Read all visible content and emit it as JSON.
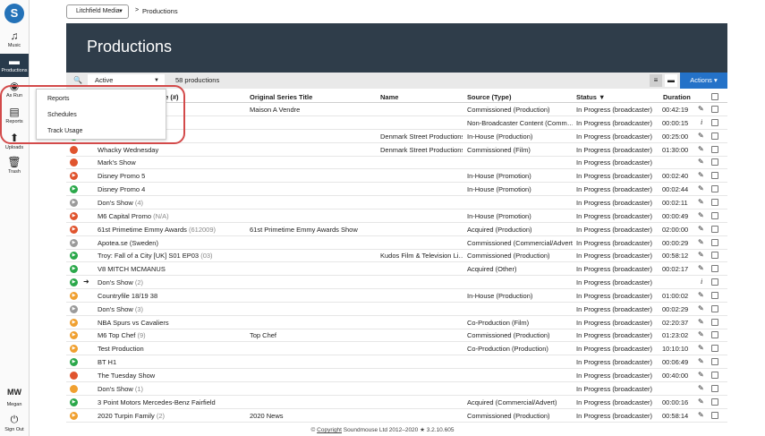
{
  "sidebar": {
    "logo": "S",
    "items": [
      {
        "label": "Music",
        "icon": "♫"
      },
      {
        "label": "Productions",
        "icon": "▬"
      },
      {
        "label": "As Run",
        "icon": "◉"
      },
      {
        "label": "Reports",
        "icon": "▤"
      },
      {
        "label": "Uploads",
        "icon": "⬆"
      },
      {
        "label": "Trash",
        "icon": "🗑"
      }
    ],
    "user_initials": "MW",
    "user_name": "Megan",
    "signout_label": "Sign Out"
  },
  "breadcrumb": {
    "org": "Litchfield Media",
    "separator": ">",
    "current": "Productions"
  },
  "header": {
    "title": "Productions"
  },
  "toolbar": {
    "filter_value": "Active",
    "count": "58 productions",
    "actions_label": "Actions ▾"
  },
  "flyout": {
    "items": [
      "Reports",
      "Schedules",
      "Track Usage"
    ]
  },
  "columns": [
    "Title (#)",
    "Original Series Title",
    "Name",
    "Source (Type)",
    "Status ▼",
    "Duration"
  ],
  "status_colors": {
    "red": "#e0542e",
    "green": "#2aa84a",
    "grey": "#9a9a9a",
    "orange": "#f0a030"
  },
  "rows": [
    {
      "status": "orange",
      "icon": "▶",
      "title": "",
      "num": "6)",
      "orig": "Maison A Vendre",
      "name": "",
      "source": "Commissioned (Production)",
      "state": "In Progress (broadcaster)",
      "dur": "00:42:19",
      "action": "edit"
    },
    {
      "status": "grey",
      "icon": "▶",
      "title": "",
      "num": "",
      "orig": "",
      "name": "",
      "source": "Non-Broadcaster Content (Comm…",
      "state": "In Progress (broadcaster)",
      "dur": "00:00:15",
      "action": "info"
    },
    {
      "status": "green",
      "icon": "▶",
      "title": "",
      "num": "",
      "orig": "",
      "name": "Denmark Street Productions",
      "source": "In-House (Production)",
      "state": "In Progress (broadcaster)",
      "dur": "00:25:00",
      "action": "edit"
    },
    {
      "status": "red",
      "icon": "",
      "title": "Whacky Wednesday",
      "num": "",
      "orig": "",
      "name": "Denmark Street Productions",
      "source": "Commissioned (Film)",
      "state": "In Progress (broadcaster)",
      "dur": "01:30:00",
      "action": "edit"
    },
    {
      "status": "red",
      "icon": "",
      "title": "Mark's Show",
      "num": "",
      "orig": "",
      "name": "",
      "source": "",
      "state": "In Progress (broadcaster)",
      "dur": "",
      "action": "edit"
    },
    {
      "status": "red",
      "icon": "▶",
      "title": "Disney Promo 5",
      "num": "",
      "orig": "",
      "name": "",
      "source": "In-House (Promotion)",
      "state": "In Progress (broadcaster)",
      "dur": "00:02:40",
      "action": "edit"
    },
    {
      "status": "green",
      "icon": "▶",
      "title": "Disney Promo 4",
      "num": "",
      "orig": "",
      "name": "",
      "source": "In-House (Promotion)",
      "state": "In Progress (broadcaster)",
      "dur": "00:02:44",
      "action": "edit"
    },
    {
      "status": "grey",
      "icon": "▶",
      "title": "Don's Show",
      "num": "(4)",
      "orig": "",
      "name": "",
      "source": "",
      "state": "In Progress (broadcaster)",
      "dur": "00:02:11",
      "action": "edit"
    },
    {
      "status": "red",
      "icon": "▶",
      "title": "M6 Capital Promo",
      "num": "(N/A)",
      "orig": "",
      "name": "",
      "source": "In-House (Promotion)",
      "state": "In Progress (broadcaster)",
      "dur": "00:00:49",
      "action": "edit"
    },
    {
      "status": "red",
      "icon": "▶",
      "title": "61st Primetime Emmy Awards",
      "num": "(612009)",
      "orig": "61st Primetime Emmy Awards Show",
      "name": "",
      "source": "Acquired (Production)",
      "state": "In Progress (broadcaster)",
      "dur": "02:00:00",
      "action": "edit"
    },
    {
      "status": "grey",
      "icon": "▶",
      "title": "Apotea.se (Sweden)",
      "num": "",
      "orig": "",
      "name": "",
      "source": "Commissioned (Commercial/Advert)",
      "state": "In Progress (broadcaster)",
      "dur": "00:00:29",
      "action": "edit"
    },
    {
      "status": "green",
      "icon": "▶",
      "title": "Troy: Fall of a City [UK] S01 EP03",
      "num": "(03)",
      "orig": "",
      "name": "Kudos Film & Television Li…",
      "source": "Commissioned (Production)",
      "state": "In Progress (broadcaster)",
      "dur": "00:58:12",
      "action": "edit"
    },
    {
      "status": "green",
      "icon": "▶",
      "title": "V8 MITCH MCMANUS",
      "num": "",
      "orig": "",
      "name": "",
      "source": "Acquired (Other)",
      "state": "In Progress (broadcaster)",
      "dur": "00:02:17",
      "action": "edit"
    },
    {
      "status": "green",
      "icon": "▶",
      "title": "Don's Show",
      "num": "(2)",
      "orig": "",
      "name": "",
      "source": "",
      "state": "In Progress (broadcaster)",
      "dur": "",
      "action": "info",
      "arrow": true
    },
    {
      "status": "orange",
      "icon": "▶",
      "title": "Countryfile 18/19 38",
      "num": "",
      "orig": "",
      "name": "",
      "source": "In-House (Production)",
      "state": "In Progress (broadcaster)",
      "dur": "01:00:02",
      "action": "edit"
    },
    {
      "status": "grey",
      "icon": "▶",
      "title": "Don's Show",
      "num": "(3)",
      "orig": "",
      "name": "",
      "source": "",
      "state": "In Progress (broadcaster)",
      "dur": "00:02:29",
      "action": "edit"
    },
    {
      "status": "orange",
      "icon": "▶",
      "title": "NBA Spurs vs Cavaliers",
      "num": "",
      "orig": "",
      "name": "",
      "source": "Co-Production (Film)",
      "state": "In Progress (broadcaster)",
      "dur": "02:20:37",
      "action": "edit"
    },
    {
      "status": "orange",
      "icon": "▶",
      "title": "M6 Top Chef",
      "num": "(9)",
      "orig": "Top Chef",
      "name": "",
      "source": "Commissioned (Production)",
      "state": "In Progress (broadcaster)",
      "dur": "01:23:02",
      "action": "edit"
    },
    {
      "status": "orange",
      "icon": "▶",
      "title": "Test Production",
      "num": "",
      "orig": "",
      "name": "",
      "source": "Co-Production (Production)",
      "state": "In Progress (broadcaster)",
      "dur": "10:10:10",
      "action": "edit"
    },
    {
      "status": "green",
      "icon": "▶",
      "title": "BT H1",
      "num": "",
      "orig": "",
      "name": "",
      "source": "",
      "state": "In Progress (broadcaster)",
      "dur": "00:06:49",
      "action": "edit"
    },
    {
      "status": "red",
      "icon": "",
      "title": "The Tuesday Show",
      "num": "",
      "orig": "",
      "name": "",
      "source": "",
      "state": "In Progress (broadcaster)",
      "dur": "00:40:00",
      "action": "edit"
    },
    {
      "status": "orange",
      "icon": "",
      "title": "Don's Show",
      "num": "(1)",
      "orig": "",
      "name": "",
      "source": "",
      "state": "In Progress (broadcaster)",
      "dur": "",
      "action": "edit"
    },
    {
      "status": "green",
      "icon": "▶",
      "title": "3 Point Motors Mercedes-Benz Fairfield",
      "num": "",
      "orig": "",
      "name": "",
      "source": "Acquired (Commercial/Advert)",
      "state": "In Progress (broadcaster)",
      "dur": "00:00:16",
      "action": "edit"
    },
    {
      "status": "orange",
      "icon": "▶",
      "title": "2020 Turpin Family",
      "num": "(2)",
      "orig": "2020 News",
      "name": "",
      "source": "Commissioned (Production)",
      "state": "In Progress (broadcaster)",
      "dur": "00:58:14",
      "action": "edit"
    }
  ],
  "footer": {
    "copyright_symbol": "©",
    "copyright_word": "Copyright",
    "rest": "Soundmouse Ltd 2012–2020 ★ 3.2.10.605"
  }
}
